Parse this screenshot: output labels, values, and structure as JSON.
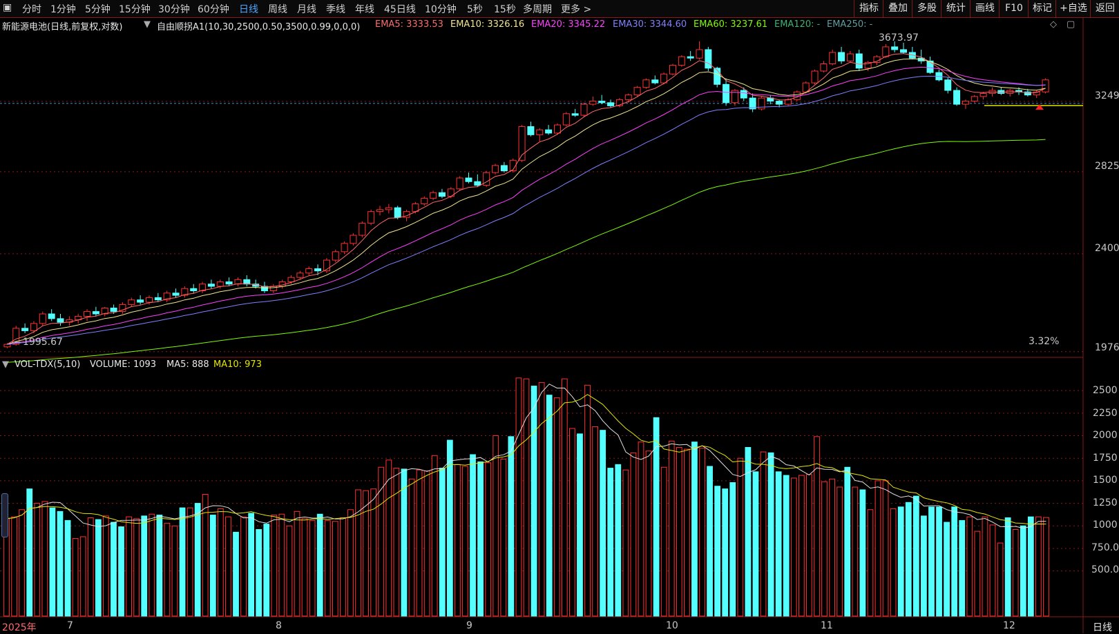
{
  "toolbar": {
    "menu_icon": "menu-icon",
    "tabs": [
      "分时",
      "1分钟",
      "5分钟",
      "15分钟",
      "30分钟",
      "60分钟",
      "日线",
      "周线",
      "月线",
      "季线",
      "年线",
      "45日线",
      "10分钟",
      "5秒",
      "15秒",
      "多周期",
      "更多 >"
    ],
    "active_tab": "日线",
    "right_buttons": [
      "指标",
      "叠加",
      "多股",
      "统计",
      "画线",
      "F10",
      "标记",
      "+自选",
      "返回"
    ]
  },
  "chart_header": {
    "title": "新能源电池(日线,前复权,对数)",
    "indicator": "自由顺拐A1(10,30,2500,0.50,3500,0.99,0,0,0)",
    "ema": [
      {
        "label": "EMA5:",
        "value": "3333.53",
        "color": "#ff6b6b"
      },
      {
        "label": "EMA10:",
        "value": "3326.16",
        "color": "#f0e68c"
      },
      {
        "label": "EMA20:",
        "value": "3345.22",
        "color": "#ff40ff"
      },
      {
        "label": "EMA30:",
        "value": "3344.60",
        "color": "#8080ff"
      },
      {
        "label": "EMA60:",
        "value": "3237.61",
        "color": "#7cfc00"
      },
      {
        "label": "EMA120:",
        "value": "-",
        "color": "#3cb371"
      },
      {
        "label": "EMA250:",
        "value": "-",
        "color": "#5f9ea0"
      }
    ]
  },
  "price_axis": {
    "labels": [
      "3249",
      "2825",
      "2400",
      "1976"
    ],
    "high_marker": "3673.97",
    "low_marker": "1995.67",
    "percent": "3.32%"
  },
  "volume_header": {
    "indicator": "VOL-TDX(5,10)",
    "volume": "VOLUME: 1093",
    "ma5": "MA5: 888",
    "ma10": "MA10: 973"
  },
  "volume_axis": {
    "labels": [
      "2500",
      "2250",
      "2000",
      "1750",
      "1500",
      "1250",
      "1000",
      "750.0",
      "500.0"
    ]
  },
  "time_axis": {
    "labels": [
      "2025年",
      "7",
      "8",
      "9",
      "10",
      "11",
      "12"
    ]
  },
  "footer": {
    "period": "日线"
  },
  "colors": {
    "up": "#ff3030",
    "down": "#54ffff",
    "grid": "#8b1a1a",
    "ma_white": "#e0e0e0",
    "ma_yellow": "#e6e600"
  },
  "chart_data": {
    "type": "candlestick",
    "y_scale": "log",
    "ohlc": [
      [
        1995,
        2010,
        1990,
        2005
      ],
      [
        2005,
        2080,
        2000,
        2070
      ],
      [
        2070,
        2090,
        2050,
        2060
      ],
      [
        2060,
        2100,
        2050,
        2090
      ],
      [
        2090,
        2140,
        2080,
        2130
      ],
      [
        2130,
        2150,
        2100,
        2110
      ],
      [
        2110,
        2130,
        2080,
        2095
      ],
      [
        2095,
        2120,
        2080,
        2105
      ],
      [
        2105,
        2130,
        2090,
        2120
      ],
      [
        2120,
        2150,
        2100,
        2140
      ],
      [
        2140,
        2160,
        2120,
        2130
      ],
      [
        2130,
        2160,
        2120,
        2155
      ],
      [
        2155,
        2170,
        2130,
        2140
      ],
      [
        2140,
        2180,
        2130,
        2170
      ],
      [
        2170,
        2200,
        2160,
        2190
      ],
      [
        2190,
        2210,
        2170,
        2180
      ],
      [
        2180,
        2210,
        2170,
        2200
      ],
      [
        2200,
        2220,
        2180,
        2190
      ],
      [
        2190,
        2230,
        2180,
        2220
      ],
      [
        2220,
        2240,
        2200,
        2210
      ],
      [
        2210,
        2250,
        2200,
        2240
      ],
      [
        2240,
        2260,
        2220,
        2230
      ],
      [
        2230,
        2270,
        2220,
        2260
      ],
      [
        2260,
        2280,
        2240,
        2250
      ],
      [
        2250,
        2280,
        2240,
        2270
      ],
      [
        2270,
        2290,
        2250,
        2260
      ],
      [
        2260,
        2290,
        2250,
        2280
      ],
      [
        2280,
        2300,
        2250,
        2260
      ],
      [
        2260,
        2280,
        2240,
        2250
      ],
      [
        2250,
        2270,
        2220,
        2230
      ],
      [
        2230,
        2260,
        2220,
        2250
      ],
      [
        2250,
        2280,
        2240,
        2270
      ],
      [
        2270,
        2300,
        2260,
        2290
      ],
      [
        2290,
        2320,
        2280,
        2310
      ],
      [
        2310,
        2340,
        2300,
        2330
      ],
      [
        2330,
        2350,
        2300,
        2320
      ],
      [
        2320,
        2380,
        2310,
        2370
      ],
      [
        2370,
        2420,
        2360,
        2410
      ],
      [
        2410,
        2460,
        2400,
        2450
      ],
      [
        2450,
        2500,
        2440,
        2490
      ],
      [
        2490,
        2560,
        2480,
        2550
      ],
      [
        2550,
        2620,
        2540,
        2610
      ],
      [
        2610,
        2640,
        2590,
        2620
      ],
      [
        2620,
        2650,
        2600,
        2630
      ],
      [
        2630,
        2640,
        2570,
        2580
      ],
      [
        2580,
        2620,
        2560,
        2610
      ],
      [
        2610,
        2660,
        2600,
        2650
      ],
      [
        2650,
        2690,
        2640,
        2680
      ],
      [
        2680,
        2720,
        2670,
        2710
      ],
      [
        2710,
        2730,
        2680,
        2690
      ],
      [
        2690,
        2740,
        2680,
        2730
      ],
      [
        2730,
        2800,
        2720,
        2790
      ],
      [
        2790,
        2820,
        2760,
        2770
      ],
      [
        2770,
        2810,
        2740,
        2750
      ],
      [
        2750,
        2830,
        2740,
        2820
      ],
      [
        2820,
        2870,
        2810,
        2860
      ],
      [
        2860,
        2880,
        2820,
        2830
      ],
      [
        2830,
        2900,
        2820,
        2890
      ],
      [
        2890,
        3100,
        2880,
        3090
      ],
      [
        3090,
        3120,
        3030,
        3040
      ],
      [
        3040,
        3080,
        3000,
        3070
      ],
      [
        3070,
        3100,
        3040,
        3050
      ],
      [
        3050,
        3110,
        3040,
        3100
      ],
      [
        3100,
        3180,
        3090,
        3170
      ],
      [
        3170,
        3200,
        3150,
        3160
      ],
      [
        3160,
        3240,
        3150,
        3230
      ],
      [
        3230,
        3280,
        3220,
        3250
      ],
      [
        3250,
        3290,
        3230,
        3240
      ],
      [
        3240,
        3260,
        3210,
        3220
      ],
      [
        3220,
        3270,
        3210,
        3260
      ],
      [
        3260,
        3300,
        3240,
        3290
      ],
      [
        3290,
        3350,
        3280,
        3340
      ],
      [
        3340,
        3400,
        3330,
        3390
      ],
      [
        3390,
        3420,
        3360,
        3370
      ],
      [
        3370,
        3440,
        3360,
        3430
      ],
      [
        3430,
        3500,
        3420,
        3490
      ],
      [
        3490,
        3560,
        3480,
        3550
      ],
      [
        3550,
        3590,
        3520,
        3540
      ],
      [
        3540,
        3660,
        3530,
        3600
      ],
      [
        3600,
        3620,
        3450,
        3470
      ],
      [
        3470,
        3480,
        3340,
        3360
      ],
      [
        3360,
        3400,
        3220,
        3240
      ],
      [
        3240,
        3330,
        3220,
        3320
      ],
      [
        3320,
        3340,
        3250,
        3270
      ],
      [
        3270,
        3300,
        3180,
        3200
      ],
      [
        3200,
        3280,
        3190,
        3270
      ],
      [
        3270,
        3290,
        3230,
        3250
      ],
      [
        3250,
        3260,
        3210,
        3230
      ],
      [
        3230,
        3270,
        3220,
        3260
      ],
      [
        3260,
        3320,
        3250,
        3310
      ],
      [
        3310,
        3380,
        3300,
        3370
      ],
      [
        3370,
        3460,
        3360,
        3450
      ],
      [
        3450,
        3520,
        3440,
        3500
      ],
      [
        3500,
        3600,
        3490,
        3580
      ],
      [
        3580,
        3620,
        3500,
        3520
      ],
      [
        3520,
        3590,
        3510,
        3570
      ],
      [
        3570,
        3600,
        3450,
        3470
      ],
      [
        3470,
        3520,
        3450,
        3510
      ],
      [
        3510,
        3560,
        3490,
        3550
      ],
      [
        3550,
        3640,
        3540,
        3620
      ],
      [
        3620,
        3660,
        3580,
        3600
      ],
      [
        3600,
        3650,
        3570,
        3580
      ],
      [
        3580,
        3620,
        3530,
        3540
      ],
      [
        3540,
        3600,
        3500,
        3520
      ],
      [
        3520,
        3550,
        3430,
        3440
      ],
      [
        3440,
        3460,
        3380,
        3390
      ],
      [
        3390,
        3410,
        3300,
        3320
      ],
      [
        3320,
        3340,
        3220,
        3230
      ],
      [
        3230,
        3260,
        3200,
        3250
      ],
      [
        3250,
        3290,
        3240,
        3280
      ],
      [
        3280,
        3310,
        3260,
        3300
      ],
      [
        3300,
        3340,
        3280,
        3320
      ],
      [
        3320,
        3340,
        3290,
        3300
      ],
      [
        3300,
        3330,
        3280,
        3320
      ],
      [
        3320,
        3340,
        3290,
        3310
      ],
      [
        3310,
        3330,
        3280,
        3290
      ],
      [
        3290,
        3320,
        3270,
        3310
      ],
      [
        3310,
        3400,
        3300,
        3390
      ]
    ],
    "volume": [
      1080,
      1100,
      1180,
      1410,
      1250,
      1270,
      1200,
      1160,
      1060,
      860,
      880,
      1090,
      1070,
      1110,
      1040,
      990,
      1100,
      1080,
      1110,
      1130,
      1120,
      1030,
      1000,
      1200,
      1200,
      1250,
      1350,
      1120,
      1190,
      1100,
      930,
      1100,
      1140,
      960,
      1020,
      1120,
      1130,
      1000,
      1160,
      1080,
      1060,
      1130,
      1060,
      1050,
      1090,
      1180,
      1400,
      1390,
      1410,
      1650,
      1730,
      1640,
      1630,
      1520,
      1620,
      1610,
      1780,
      1640,
      1950,
      1680,
      1660,
      1790,
      1710,
      1700,
      2000,
      1740,
      1990,
      2640,
      2630,
      2550,
      2590,
      2450,
      2420,
      2630,
      2080,
      2020,
      2560,
      2100,
      2060,
      1640,
      1680,
      1620,
      1810,
      1930,
      1830,
      2200,
      1650,
      1940,
      1870,
      1850,
      1930,
      1860,
      1660,
      1440,
      1410,
      1480,
      1750,
      1870,
      1600,
      1820,
      1810,
      1600,
      1560,
      1530,
      1560,
      1570,
      1990,
      1490,
      1520,
      1430,
      1650,
      1430,
      1400,
      1180,
      1500,
      1500,
      1190,
      1210,
      1260,
      1330,
      1110,
      1210,
      1210,
      1040,
      1210,
      1060,
      1100,
      940,
      1100,
      1010,
      810,
      1090,
      960,
      1000,
      1100,
      1100,
      1093
    ],
    "volume_ma5": 888,
    "volume_ma10": 973
  }
}
